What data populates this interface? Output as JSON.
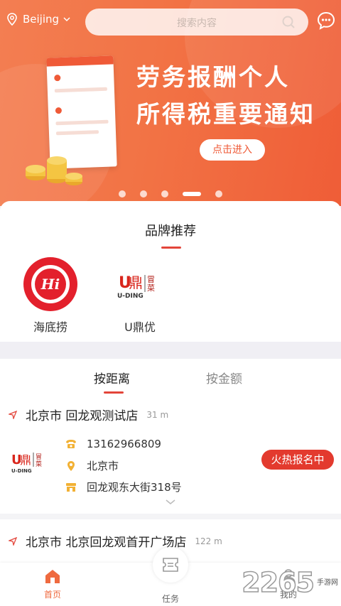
{
  "header": {
    "city": "Beijing",
    "search_placeholder": "搜索内容"
  },
  "banner": {
    "headline_line1": "劳务报酬个人",
    "headline_line2": "所得税重要通知",
    "cta": "点击进入",
    "slide_count": 5,
    "active_slide": 4
  },
  "brands": {
    "title": "品牌推荐",
    "items": [
      {
        "name": "海底捞",
        "logo_text": "Hi"
      },
      {
        "name": "U鼎优",
        "logo_text": "U-DING"
      }
    ]
  },
  "tabs": [
    {
      "label": "按距离",
      "active": true
    },
    {
      "label": "按金额",
      "active": false
    }
  ],
  "stores": [
    {
      "name": "北京市 回龙观测试店",
      "distance": "31 m",
      "phone": "13162966809",
      "city": "北京市",
      "address": "回龙观东大街318号",
      "status": "火热报名中",
      "logo_text": "U-DING"
    },
    {
      "name": "北京市 北京回龙观首开广场店",
      "distance": "122 m"
    }
  ],
  "tabbar": {
    "home": "首页",
    "task": "任务",
    "mine": "我的"
  },
  "watermark": {
    "number": "2265",
    "site": "手游网"
  },
  "colors": {
    "accent": "#e33a2e",
    "banner": "#f27345",
    "icon_gold": "#f2b134"
  }
}
